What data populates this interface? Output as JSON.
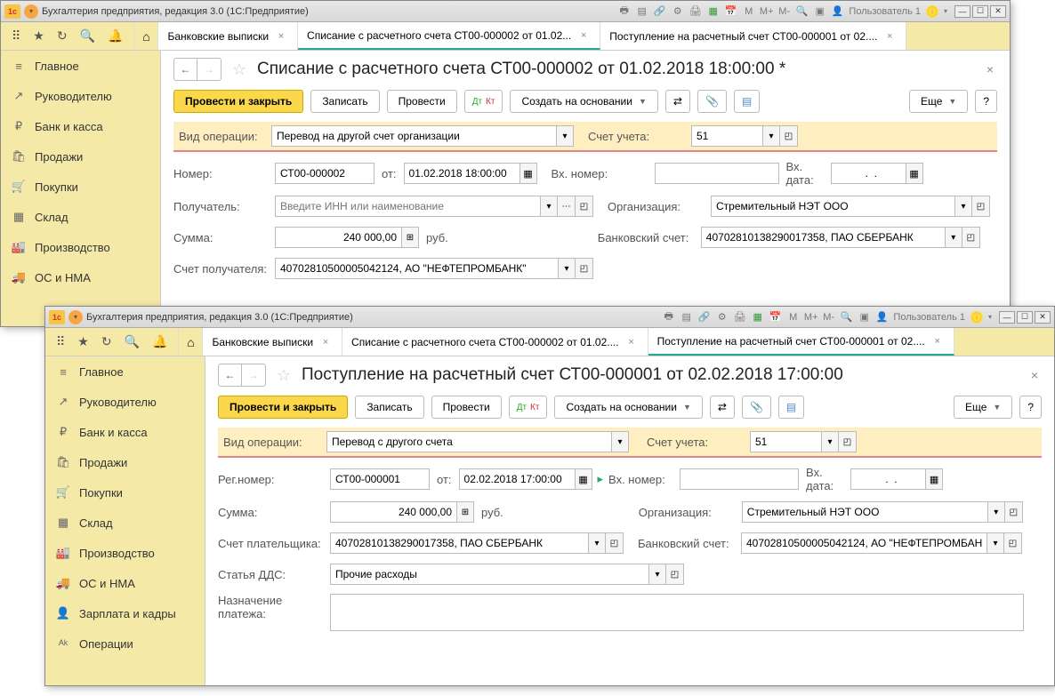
{
  "win1": {
    "title": "Бухгалтерия предприятия, редакция 3.0  (1С:Предприятие)",
    "user": "Пользователь 1",
    "tabs": [
      {
        "label": "Банковские выписки"
      },
      {
        "label": "Списание с расчетного счета СТ00-000002 от 01.02...",
        "active": true
      },
      {
        "label": "Поступление на расчетный счет СТ00-000001 от 02...."
      }
    ],
    "nav": [
      {
        "icon": "≡",
        "label": "Главное"
      },
      {
        "icon": "↗",
        "label": "Руководителю"
      },
      {
        "icon": "₽",
        "label": "Банк и касса"
      },
      {
        "icon": "🛍",
        "label": "Продажи"
      },
      {
        "icon": "🛒",
        "label": "Покупки"
      },
      {
        "icon": "▦",
        "label": "Склад"
      },
      {
        "icon": "🏭",
        "label": "Производство"
      },
      {
        "icon": "🚚",
        "label": "ОС и НМА"
      }
    ],
    "page": {
      "title": "Списание с расчетного счета СТ00-000002 от 01.02.2018 18:00:00 *",
      "btn_primary": "Провести и закрыть",
      "btn_write": "Записать",
      "btn_post": "Провести",
      "btn_createon": "Создать на основании",
      "btn_more": "Еще",
      "lbl_optype": "Вид операции:",
      "val_optype": "Перевод на другой счет организации",
      "lbl_account": "Счет учета:",
      "val_account": "51",
      "lbl_num": "Номер:",
      "val_num": "СТ00-000002",
      "lbl_from": "от:",
      "val_date": "01.02.2018 18:00:00",
      "lbl_extnum": "Вх. номер:",
      "lbl_extdate": "Вх. дата:",
      "val_extdate": "  .  .",
      "lbl_recipient": "Получатель:",
      "ph_recipient": "Введите ИНН или наименование",
      "lbl_org": "Организация:",
      "val_org": "Стремительный НЭТ ООО",
      "lbl_sum": "Сумма:",
      "val_sum": "240 000,00",
      "lbl_rub": "руб.",
      "lbl_bankacc": "Банковский счет:",
      "val_bankacc": "40702810138290017358, ПАО СБЕРБАНК",
      "lbl_recacc": "Счет получателя:",
      "val_recacc": "40702810500005042124, АО \"НЕФТЕПРОМБАНК\""
    }
  },
  "win2": {
    "title": "Бухгалтерия предприятия, редакция 3.0  (1С:Предприятие)",
    "user": "Пользователь 1",
    "tabs": [
      {
        "label": "Банковские выписки"
      },
      {
        "label": "Списание с расчетного счета СТ00-000002 от 01.02...."
      },
      {
        "label": "Поступление на расчетный счет СТ00-000001 от 02....",
        "active": true
      }
    ],
    "nav": [
      {
        "icon": "≡",
        "label": "Главное"
      },
      {
        "icon": "↗",
        "label": "Руководителю"
      },
      {
        "icon": "₽",
        "label": "Банк и касса"
      },
      {
        "icon": "🛍",
        "label": "Продажи"
      },
      {
        "icon": "🛒",
        "label": "Покупки"
      },
      {
        "icon": "▦",
        "label": "Склад"
      },
      {
        "icon": "🏭",
        "label": "Производство"
      },
      {
        "icon": "🚚",
        "label": "ОС и НМА"
      },
      {
        "icon": "👤",
        "label": "Зарплата и кадры"
      },
      {
        "icon": "ᴬᵏ",
        "label": "Операции"
      }
    ],
    "page": {
      "title": "Поступление на расчетный счет СТ00-000001 от 02.02.2018 17:00:00",
      "btn_primary": "Провести и закрыть",
      "btn_write": "Записать",
      "btn_post": "Провести",
      "btn_createon": "Создать на основании",
      "btn_more": "Еще",
      "lbl_optype": "Вид операции:",
      "val_optype": "Перевод с другого счета",
      "lbl_account": "Счет учета:",
      "val_account": "51",
      "lbl_num": "Рег.номер:",
      "val_num": "СТ00-000001",
      "lbl_from": "от:",
      "val_date": "02.02.2018 17:00:00",
      "lbl_extnum": "Вх. номер:",
      "lbl_extdate": "Вх. дата:",
      "val_extdate": "  .  .",
      "lbl_sum": "Сумма:",
      "val_sum": "240 000,00",
      "lbl_rub": "руб.",
      "lbl_org": "Организация:",
      "val_org": "Стремительный НЭТ ООО",
      "lbl_payeracc": "Счет плательщика:",
      "val_payeracc": "40702810138290017358, ПАО СБЕРБАНК",
      "lbl_bankacc": "Банковский счет:",
      "val_bankacc": "40702810500005042124, АО \"НЕФТЕПРОМБАН",
      "lbl_dds": "Статья ДДС:",
      "val_dds": "Прочие расходы",
      "lbl_purpose": "Назначение платежа:"
    }
  }
}
